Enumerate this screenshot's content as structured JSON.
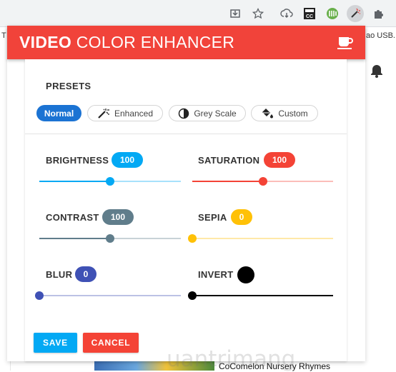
{
  "browser": {
    "extension_icons": [
      "download-box-icon",
      "star-icon",
      "cloud-download-icon",
      "seek-cc-icon",
      "green-ext-icon",
      "magic-wand-icon",
      "puzzle-icon"
    ]
  },
  "background": {
    "left_tag": "T",
    "right_text": "ao USB...",
    "video_caption": "CoComelon Nursery Rhymes"
  },
  "popup": {
    "title_bold": "VIDEO",
    "title_rest": " COLOR ENHANCER",
    "presets_title": "PRESETS",
    "presets": [
      {
        "label": "Normal",
        "icon": "none",
        "active": true
      },
      {
        "label": "Enhanced",
        "icon": "magic-wand-icon",
        "active": false
      },
      {
        "label": "Grey Scale",
        "icon": "contrast-icon",
        "active": false
      },
      {
        "label": "Custom",
        "icon": "paint-bucket-icon",
        "active": false
      }
    ],
    "controls": {
      "brightness": {
        "label": "BRIGHTNESS",
        "value": "100",
        "level": 0.5,
        "color": "#03a9f4"
      },
      "saturation": {
        "label": "SATURATION",
        "value": "100",
        "level": 0.5,
        "color": "#f44336"
      },
      "contrast": {
        "label": "CONTRAST",
        "value": "100",
        "level": 0.5,
        "color": "#607d8b"
      },
      "sepia": {
        "label": "SEPIA",
        "value": "0",
        "level": 0.0,
        "color": "#ffc107"
      },
      "blur": {
        "label": "BLUR",
        "value": "0",
        "level": 0.0,
        "color": "#3f51b5"
      },
      "invert": {
        "label": "INVERT",
        "level": 0.0,
        "color": "#000000"
      }
    },
    "save_label": "SAVE",
    "cancel_label": "CANCEL",
    "watermark": "uantrimang"
  }
}
